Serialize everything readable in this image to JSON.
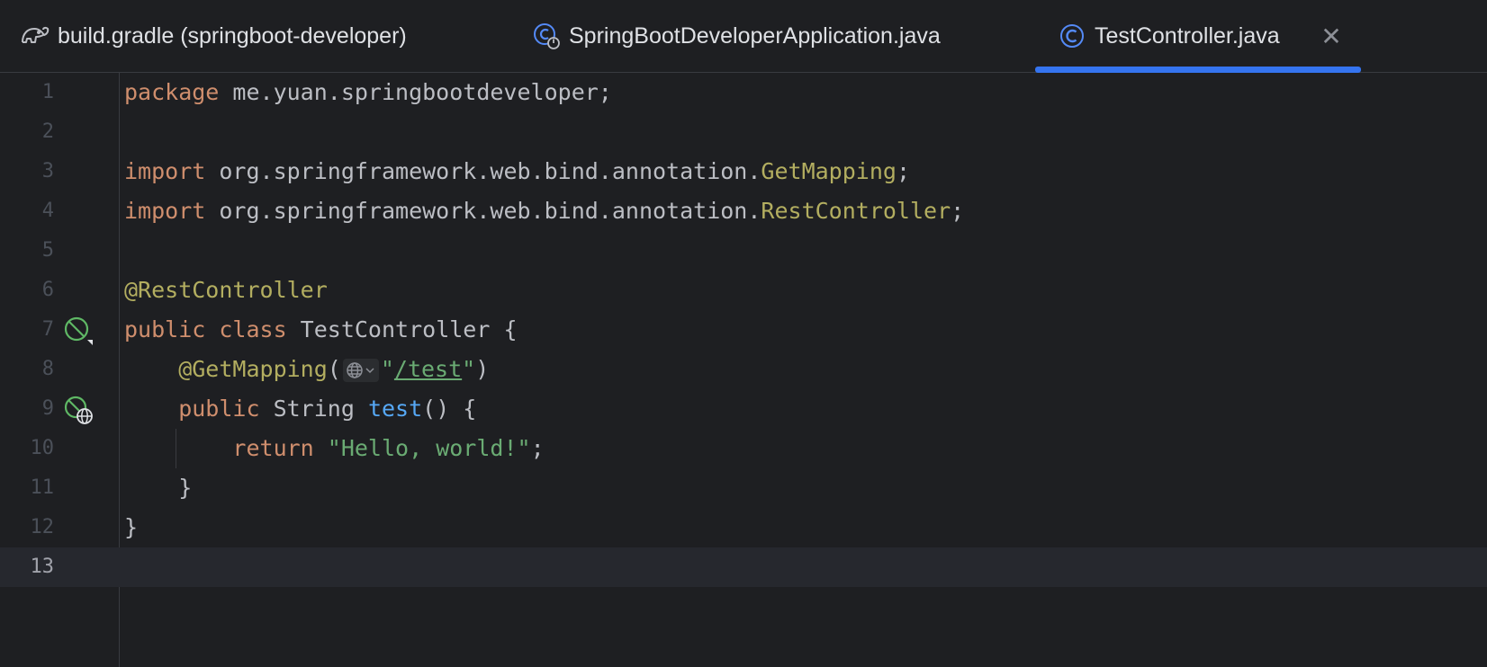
{
  "tabs": [
    {
      "label": "build.gradle (springboot-developer)",
      "icon": "gradle-elephant-icon",
      "active": false
    },
    {
      "label": "SpringBootDeveloperApplication.java",
      "icon": "spring-boot-class-icon",
      "active": false
    },
    {
      "label": "TestController.java",
      "icon": "java-class-icon",
      "active": true
    }
  ],
  "close_glyph": "✕",
  "colors": {
    "accent": "#3574f0",
    "keyword": "#cf8e6d",
    "annotation": "#b3ae60",
    "string": "#6aab73",
    "method": "#56a8f5",
    "text": "#bcbec4"
  },
  "current_line": 13,
  "lines": [
    {
      "n": "1",
      "pkg_kw": "package",
      "pkg_name": " me.yuan.springbootdeveloper;"
    },
    {
      "n": "2"
    },
    {
      "n": "3",
      "kw": "import",
      "path": " org.springframework.web.bind.annotation.",
      "cls": "GetMapping",
      "end": ";"
    },
    {
      "n": "4",
      "kw": "import",
      "path": " org.springframework.web.bind.annotation.",
      "cls": "RestController",
      "end": ";"
    },
    {
      "n": "5"
    },
    {
      "n": "6",
      "annotation": "@RestController"
    },
    {
      "n": "7",
      "kw1": "public",
      "kw2": " class",
      "name": " TestController {",
      "gutter_icon": "spring-bean-icon"
    },
    {
      "n": "8",
      "annotation": "    @GetMapping",
      "open": "(",
      "q1": "\"",
      "url": "/test",
      "q2": "\"",
      "close": ")",
      "inlay_icon": "globe-icon"
    },
    {
      "n": "9",
      "kw": "    public",
      "type": " String ",
      "method": "test",
      "rest": "() {",
      "gutter_icon": "spring-endpoint-icon"
    },
    {
      "n": "10",
      "kw": "        return",
      "space": " ",
      "str": "\"Hello, world!\"",
      "end": ";"
    },
    {
      "n": "11",
      "text": "    }"
    },
    {
      "n": "12",
      "text": "}"
    },
    {
      "n": "13"
    }
  ]
}
